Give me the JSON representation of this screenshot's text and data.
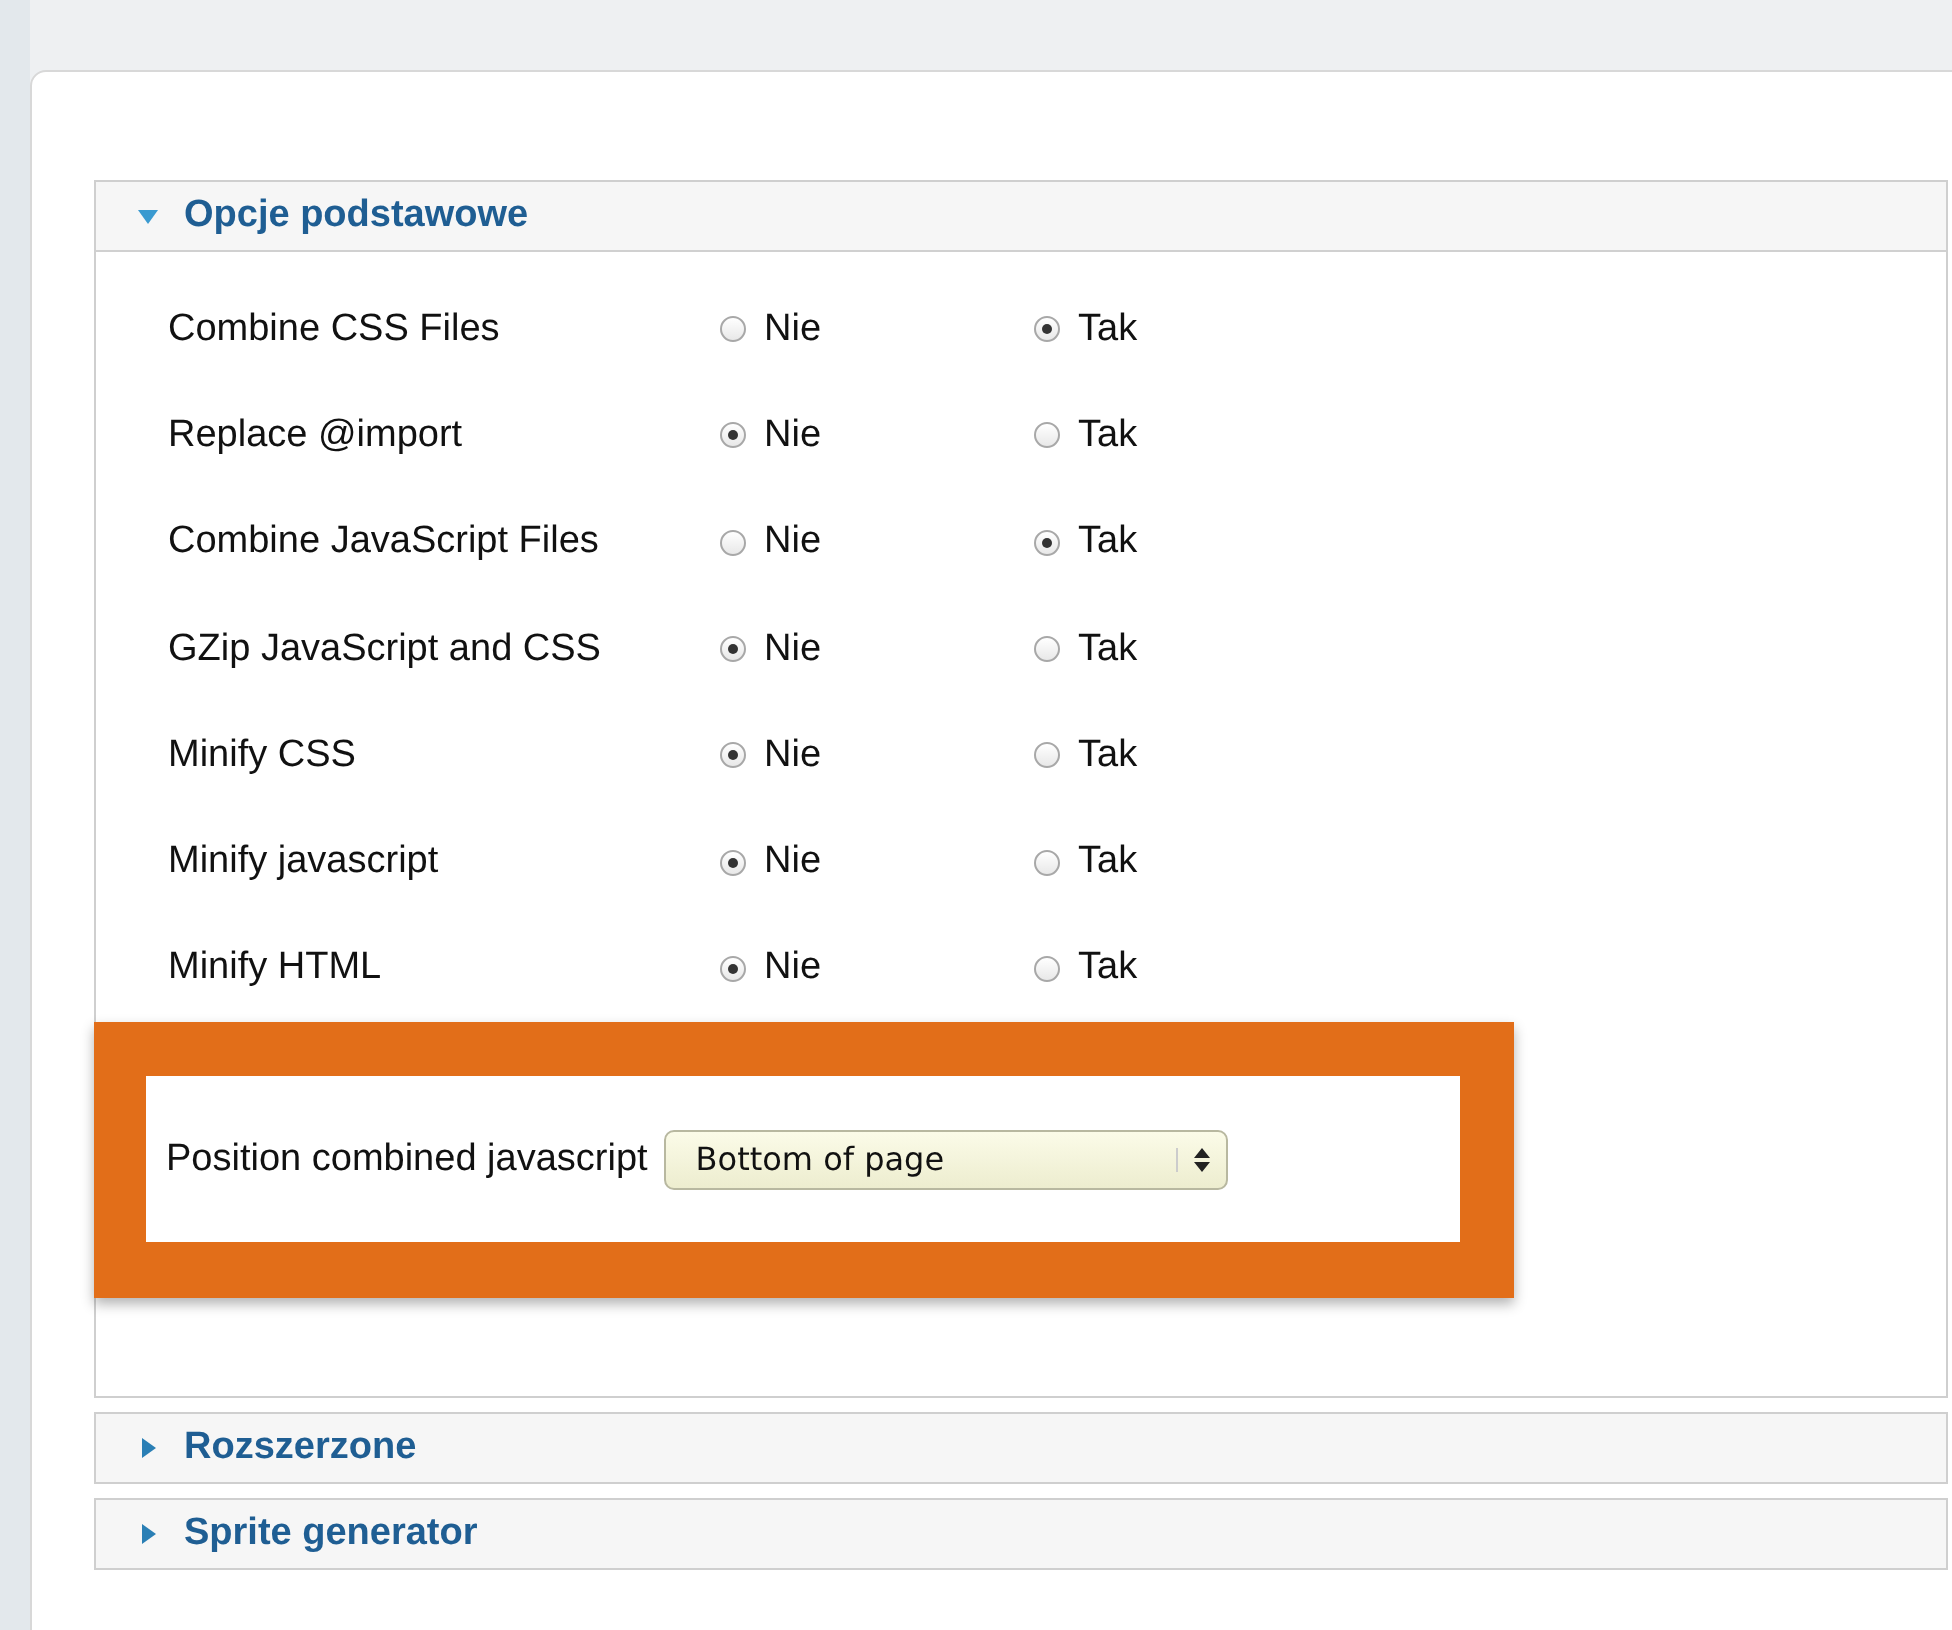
{
  "panels": [
    {
      "title": "Opcje podstawowe",
      "expanded": true,
      "options": [
        {
          "label": "Combine CSS Files",
          "choices": [
            {
              "label": "Nie",
              "selected": false
            },
            {
              "label": "Tak",
              "selected": true
            }
          ]
        },
        {
          "label": "Replace @import",
          "choices": [
            {
              "label": "Nie",
              "selected": true
            },
            {
              "label": "Tak",
              "selected": false
            }
          ]
        },
        {
          "label": "Combine JavaScript Files",
          "choices": [
            {
              "label": "Nie",
              "selected": false
            },
            {
              "label": "Tak",
              "selected": true
            }
          ]
        },
        {
          "label": "GZip JavaScript and CSS",
          "choices": [
            {
              "label": "Nie",
              "selected": true
            },
            {
              "label": "Tak",
              "selected": false
            }
          ]
        },
        {
          "label": "Minify CSS",
          "choices": [
            {
              "label": "Nie",
              "selected": true
            },
            {
              "label": "Tak",
              "selected": false
            }
          ]
        },
        {
          "label": "Minify javascript",
          "choices": [
            {
              "label": "Nie",
              "selected": true
            },
            {
              "label": "Tak",
              "selected": false
            }
          ]
        },
        {
          "label": "Minify HTML",
          "choices": [
            {
              "label": "Nie",
              "selected": true
            },
            {
              "label": "Tak",
              "selected": false
            }
          ]
        }
      ],
      "highlight": {
        "label": "Position combined javascript",
        "select": {
          "value": "Bottom of page"
        }
      }
    },
    {
      "title": "Rozszerzone",
      "expanded": false
    },
    {
      "title": "Sprite generator",
      "expanded": false
    }
  ]
}
